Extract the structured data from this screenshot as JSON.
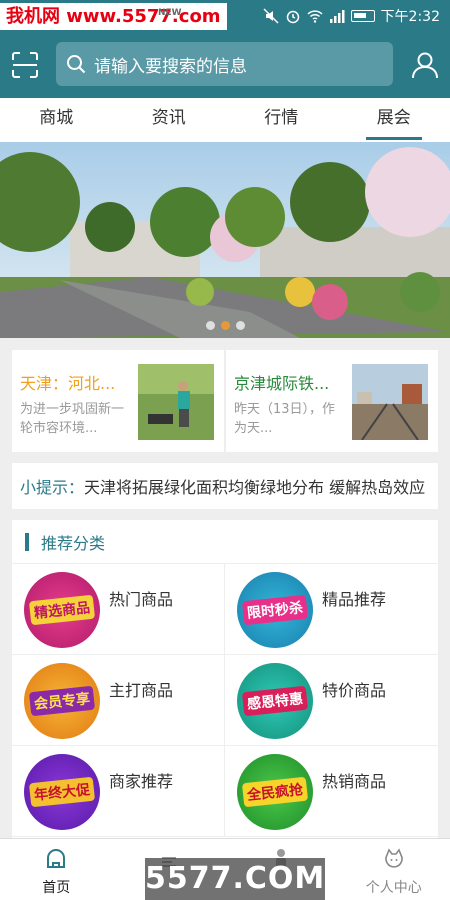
{
  "watermark_top": "我机网 www.5577.com",
  "status": {
    "time": "下午2:32"
  },
  "header": {
    "search_placeholder": "请输入要搜索的信息"
  },
  "tabs": [
    {
      "label": "商城",
      "active": false
    },
    {
      "label": "资讯",
      "active": false
    },
    {
      "label": "行情",
      "active": false
    },
    {
      "label": "展会",
      "active": true
    }
  ],
  "banner": {
    "dots": 3,
    "active_dot": 1
  },
  "news": [
    {
      "title": "天津：河北...",
      "title_color": "#f0a020",
      "desc": "为进一步巩固新一轮市容环境..."
    },
    {
      "title": "京津城际铁...",
      "title_color": "#2a8a3a",
      "desc": "昨天（13日），作为天..."
    }
  ],
  "tip": {
    "label": "小提示：",
    "text": "天津将拓展绿化面积均衡绿地分布 缓解热岛效应"
  },
  "categories": {
    "title": "推荐分类",
    "items": [
      {
        "label": "热门商品",
        "badge": "精选商品"
      },
      {
        "label": "精品推荐",
        "badge": "限时秒杀"
      },
      {
        "label": "主打商品",
        "badge": "会员专享"
      },
      {
        "label": "特价商品",
        "badge": "感恩特惠"
      },
      {
        "label": "商家推荐",
        "badge": "年终大促"
      },
      {
        "label": "热销商品",
        "badge": "全民疯抢"
      }
    ]
  },
  "bottom_nav": [
    {
      "label": "首页",
      "icon": "home-icon",
      "active": true
    },
    {
      "label": "",
      "icon": "news-icon",
      "active": false
    },
    {
      "label": "",
      "icon": "mall-icon",
      "active": false
    },
    {
      "label": "个人中心",
      "icon": "profile-icon",
      "active": false
    }
  ],
  "new_tag": "NEW",
  "watermark_bottom": "5577.COM",
  "colors": {
    "primary": "#2b7a88",
    "accent": "#f29a2e"
  }
}
